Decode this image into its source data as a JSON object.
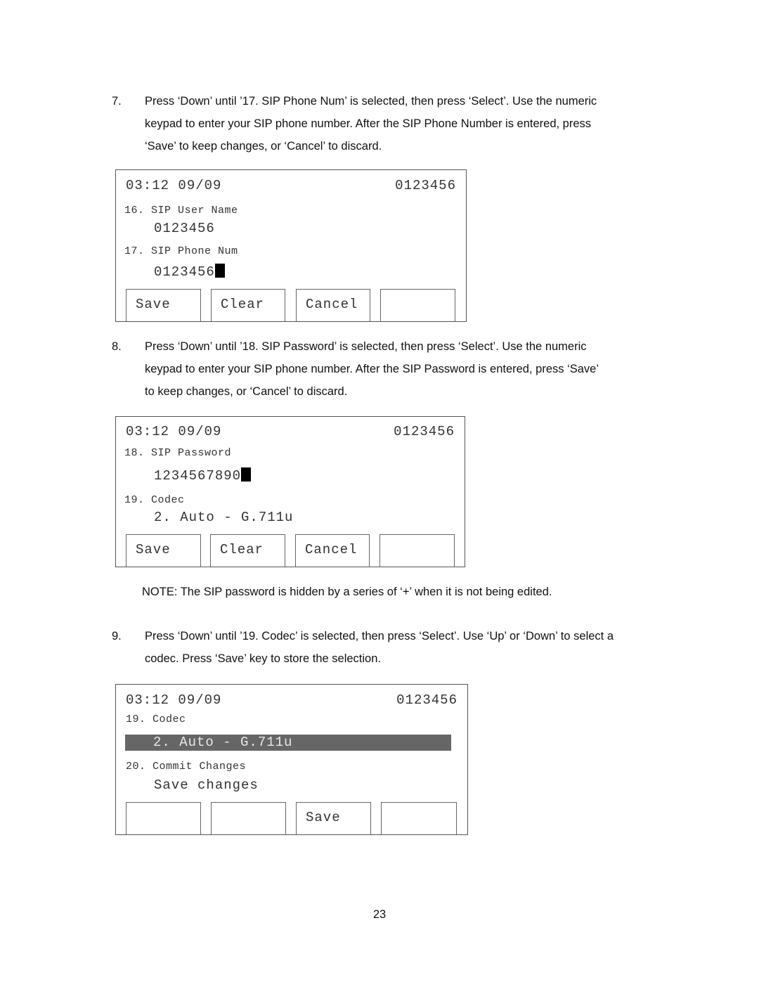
{
  "steps": [
    {
      "number": "7.",
      "lines": [
        "Press ‘Down’ until ’17. SIP Phone Num’ is selected, then press ‘Select’.    Use the numeric",
        "keypad to enter your SIP phone number.    After the SIP Phone Number is entered, press",
        "‘Save’ to keep changes, or ‘Cancel’ to discard."
      ]
    },
    {
      "number": "8.",
      "lines": [
        "Press ‘Down’ until ’18. SIP Password’ is selected, then press ‘Select’.    Use the numeric",
        "keypad to enter your SIP phone number.    After the SIP Password is entered, press ‘Save’",
        "to keep changes, or ‘Cancel’ to discard."
      ]
    },
    {
      "number": "9.",
      "lines": [
        "Press ‘Down’ until ’19. Codec’ is selected, then press ‘Select’. Use ‘Up’ or ‘Down’ to select a",
        "codec.    Press ‘Save’ key to store the selection."
      ]
    }
  ],
  "note": "NOTE: The SIP password is hidden by a series of ‘+’ when it is not being edited.",
  "screens": [
    {
      "time": "03:12 09/09",
      "extension": "0123456",
      "items": [
        {
          "label": "16. SIP User Name",
          "value": "0123456"
        },
        {
          "label": "17. SIP Phone Num",
          "value": "0123456",
          "editing": true
        }
      ],
      "softkeys": [
        "Save",
        "Clear",
        "Cancel",
        ""
      ]
    },
    {
      "time": "03:12 09/09",
      "extension": "0123456",
      "items": [
        {
          "label": "18. SIP Password",
          "value": "1234567890",
          "editing": true
        },
        {
          "label": "19. Codec",
          "value": "2. Auto - G.711u"
        }
      ],
      "softkeys": [
        "Save",
        "Clear",
        "Cancel",
        ""
      ]
    },
    {
      "time": "03:12 09/09",
      "extension": "0123456",
      "items": [
        {
          "label": "19. Codec",
          "value": "2. Auto - G.711u",
          "highlighted": true
        },
        {
          "label": "20. Commit Changes",
          "value": "Save changes"
        }
      ],
      "softkeys": [
        "",
        "",
        "Save",
        ""
      ]
    }
  ],
  "colors": {
    "highlight_bg": "#666666",
    "highlight_text": "#e8e8e8",
    "cursor": "#000000"
  },
  "page_number": "23"
}
